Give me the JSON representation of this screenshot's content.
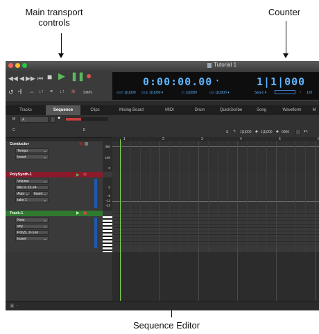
{
  "callouts": {
    "transport": "Main transport controls",
    "counter": "Counter",
    "sequence_editor": "Sequence Editor"
  },
  "window": {
    "title": "Tutorial 1"
  },
  "counter": {
    "main_time": "0:00:00.00",
    "bars": "1|1|000",
    "start_label": "start",
    "start_value": "1|1|000",
    "stop_label": "stop",
    "stop_value": "1|1|000",
    "in_label": "In",
    "in_value": "1|1|000",
    "out_label": "out",
    "out_value": "1|1|000",
    "seq_label": "Seq-1",
    "tempo_hint": "120"
  },
  "transport": {
    "samples_label": "SMPL"
  },
  "tabs": [
    {
      "label": "Tracks",
      "active": false
    },
    {
      "label": "Sequence",
      "active": true
    },
    {
      "label": "Clips",
      "active": false
    },
    {
      "label": "Mixing Board",
      "active": false
    },
    {
      "label": "MIDI",
      "active": false
    },
    {
      "label": "Drum",
      "active": false
    },
    {
      "label": "QuickScribe",
      "active": false
    },
    {
      "label": "Song",
      "active": false
    },
    {
      "label": "Waveform",
      "active": false
    },
    {
      "label": "M",
      "active": false
    }
  ],
  "seqbar": {
    "m_label": "M",
    "a_label": "A",
    "c_label": "C",
    "e_label": "E",
    "s_label": "S",
    "loc1": "1|1|000",
    "loc2": "1|1|000",
    "loc3": "0000"
  },
  "timeline": {
    "bars": [
      "1",
      "2",
      "3",
      "4",
      "5",
      "6"
    ]
  },
  "tracks": {
    "conductor": {
      "name": "Conductor",
      "fields": [
        "Tempo",
        "Insert"
      ],
      "ruler": [
        "360",
        "180",
        "0"
      ]
    },
    "polysynth": {
      "name": "PolySynth-1",
      "fields": [
        "Volume",
        "Mix In 23-24",
        "Auto",
        "Insert",
        "take 1"
      ],
      "ruler": [
        "0",
        "-6",
        "-12",
        "-24"
      ]
    },
    "track1": {
      "name": "Track-1",
      "fields": [
        "Note",
        "any",
        "PolyS...h-1-in",
        "Insert"
      ]
    }
  },
  "colors": {
    "counter_digits": "#5fb5ff",
    "cursor": "#7fd24a",
    "polysynth_header": "#8b1a2b",
    "track1_header": "#2f7a2f"
  }
}
